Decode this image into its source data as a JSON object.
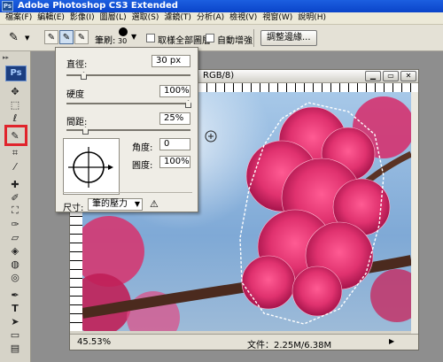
{
  "app": {
    "title": "Adobe Photoshop CS3 Extended",
    "icon_text": "Ps"
  },
  "menu": [
    "檔案(F)",
    "編輯(E)",
    "影像(I)",
    "圖層(L)",
    "選取(S)",
    "濾鏡(T)",
    "分析(A)",
    "檢視(V)",
    "視窗(W)",
    "說明(H)"
  ],
  "options": {
    "brush_label": "筆刷:",
    "brush_size": "30",
    "sample_all_layers": "取樣全部圖層",
    "auto_enhance": "自動增強",
    "refine_edge": "調整邊緣..."
  },
  "brush_panel": {
    "diameter_label": "直徑:",
    "diameter_value": "30 px",
    "hardness_label": "硬度",
    "hardness_value": "100%",
    "spacing_label": "間距:",
    "spacing_value": "25%",
    "angle_label": "角度:",
    "angle_value": "0",
    "roundness_label": "圓度:",
    "roundness_value": "100%",
    "size_label": "尺寸:",
    "size_value": "筆的壓力",
    "warning_icon": "warning-icon"
  },
  "document": {
    "title_fragment": "RGB/8)",
    "zoom": "45.53%",
    "doc_info": "文件：2.25M/6.38M"
  },
  "toolbox": {
    "logo": "Ps"
  },
  "colors": {
    "title_blue": "#0a44c9",
    "highlight_red": "#e0242c",
    "flower_pink": "#e0326f"
  }
}
